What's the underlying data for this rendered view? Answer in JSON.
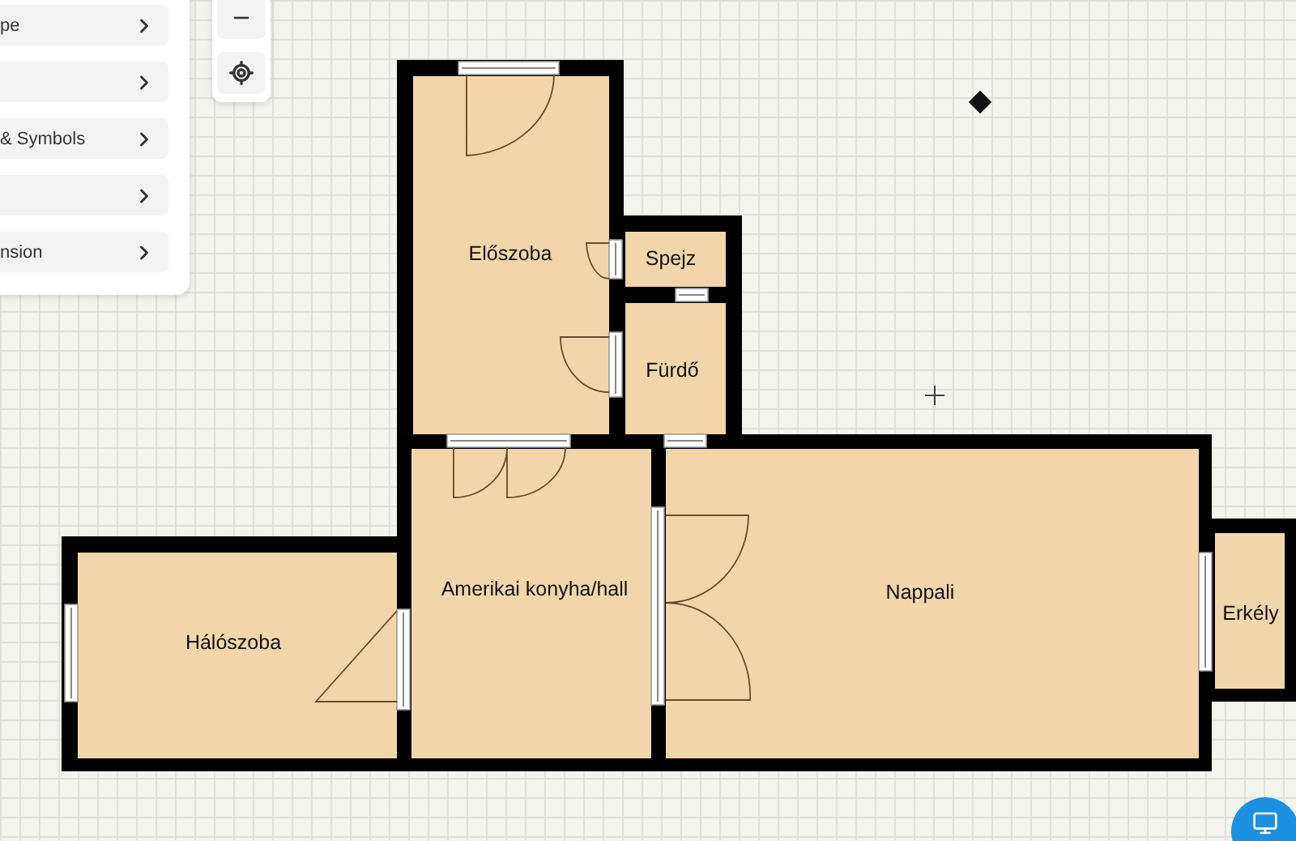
{
  "menu": {
    "items": [
      {
        "kind": "labeled",
        "label": "pe"
      },
      {
        "kind": "blank"
      },
      {
        "kind": "labeled",
        "label": "& Symbols"
      },
      {
        "kind": "blank"
      },
      {
        "kind": "labeled",
        "label": "nsion"
      }
    ]
  },
  "floor_plan": {
    "rooms": [
      {
        "name": "Előszoba"
      },
      {
        "name": "Spejz"
      },
      {
        "name": "Fürdő"
      },
      {
        "name": "Amerikai konyha/hall"
      },
      {
        "name": "Nappali"
      },
      {
        "name": "Hálószoba"
      },
      {
        "name": "Erkély"
      }
    ]
  }
}
